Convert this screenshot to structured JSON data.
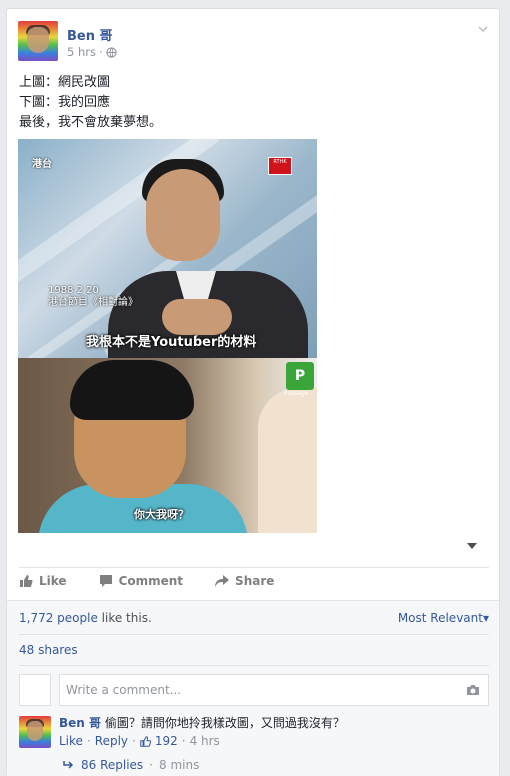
{
  "post": {
    "author": "Ben 哥",
    "time": "5 hrs",
    "separator": "·",
    "text_lines": [
      "上圖：網民改圖",
      "下圖：我的回應",
      "最後，我不會放棄夢想。"
    ],
    "photo_top": {
      "channel": "港台",
      "station_badge": "RTHK",
      "date_caption": "1988 2 20",
      "program_caption": "港台節目《相對論》",
      "subtitle": "我根本不是Youtuber的材料"
    },
    "photo_bottom": {
      "logo_letter": "P",
      "logo_label": "Passage",
      "subtitle": "你大我呀？"
    }
  },
  "actions": {
    "like": "Like",
    "comment": "Comment",
    "share": "Share"
  },
  "footer": {
    "likes_count": "1,772 people",
    "likes_suffix": " like this.",
    "sort": "Most Relevant",
    "shares": "48 shares",
    "comment_placeholder": "Write a comment..."
  },
  "comment": {
    "author": "Ben 哥",
    "text": "偷圖？請問你地拎我樣改圖，又問過我沒有？",
    "like": "Like",
    "dot": "·",
    "reply": "Reply",
    "reactions": "192",
    "time": "4 hrs",
    "replies": "86 Replies",
    "replies_time": "8 mins"
  },
  "colors": {
    "link": "#365899",
    "muted": "#90949c",
    "background": "#e9ebee"
  }
}
